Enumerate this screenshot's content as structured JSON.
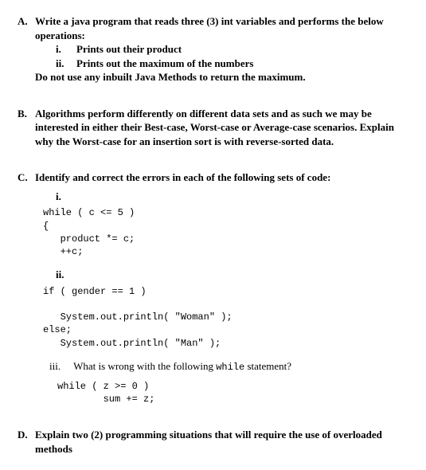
{
  "A": {
    "letter": "A.",
    "intro": "Write a java program that reads three (3) int variables and performs the below operations:",
    "items": [
      {
        "num": "i.",
        "text": "Prints out their product"
      },
      {
        "num": "ii.",
        "text": "Prints out the maximum of the numbers"
      }
    ],
    "note": "Do not use any inbuilt Java Methods to return the maximum."
  },
  "B": {
    "letter": "B.",
    "text": "Algorithms perform differently on different data sets and as such we may be interested in either their Best-case, Worst-case or Average-case scenarios. Explain why the Worst-case for an insertion sort is with reverse-sorted data."
  },
  "C": {
    "letter": "C.",
    "intro": "Identify and correct the errors in each of the following sets of code:",
    "i_label": "i.",
    "i_code": "while ( c <= 5 )\n{\n   product *= c;\n   ++c;",
    "ii_label": "ii.",
    "ii_code": "if ( gender == 1 )\n\n   System.out.println( \"Woman\" );\nelse;\n   System.out.println( \"Man\" );",
    "iii_label": "iii.",
    "iii_text_lead": "What is wrong with the following ",
    "iii_text_mono": "while",
    "iii_text_tail": " statement?",
    "iii_code": "while ( z >= 0 )\n        sum += z;"
  },
  "D": {
    "letter": "D.",
    "text": "Explain two (2) programming situations that will require the use of overloaded methods"
  }
}
